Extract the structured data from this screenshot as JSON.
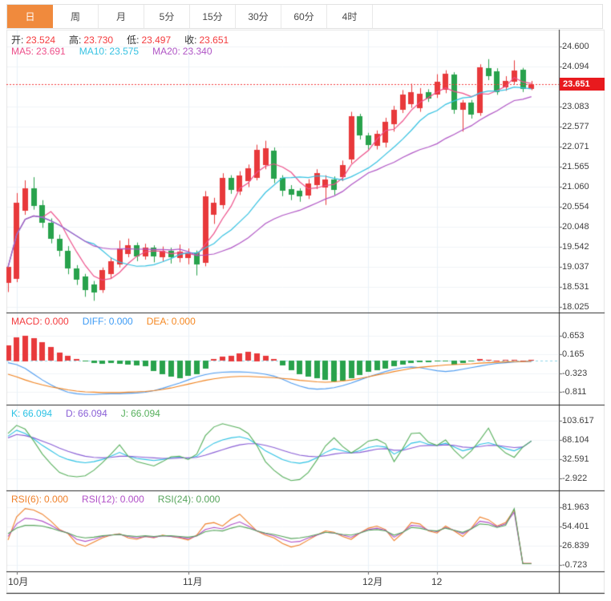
{
  "tabs": [
    {
      "label": "日",
      "active": true
    },
    {
      "label": "周",
      "active": false
    },
    {
      "label": "月",
      "active": false
    },
    {
      "label": "5分",
      "active": false
    },
    {
      "label": "15分",
      "active": false
    },
    {
      "label": "30分",
      "active": false
    },
    {
      "label": "60分",
      "active": false
    },
    {
      "label": "4时",
      "active": false
    }
  ],
  "readouts": {
    "ohlc": [
      {
        "label": "开:",
        "value": "23.524",
        "label_color": "#333333",
        "value_color": "#f43b3e"
      },
      {
        "label": "高:",
        "value": "23.730",
        "label_color": "#333333",
        "value_color": "#f43b3e"
      },
      {
        "label": "低:",
        "value": "23.497",
        "label_color": "#333333",
        "value_color": "#f43b3e"
      },
      {
        "label": "收:",
        "value": "23.651",
        "label_color": "#333333",
        "value_color": "#f43b3e"
      }
    ],
    "ma": [
      {
        "label": "MA5:",
        "value": "23.691",
        "color": "#ee4f8a"
      },
      {
        "label": "MA10:",
        "value": "23.575",
        "color": "#35c2e2"
      },
      {
        "label": "MA20:",
        "value": "23.340",
        "color": "#b055c5"
      }
    ],
    "macd": [
      {
        "label": "MACD:",
        "value": "0.000",
        "color": "#f43b3e"
      },
      {
        "label": "DIFF:",
        "value": "0.000",
        "color": "#3d9bf5"
      },
      {
        "label": "DEA:",
        "value": "0.000",
        "color": "#f58822"
      }
    ],
    "kdj": [
      {
        "label": "K:",
        "value": "66.094",
        "color": "#2cc2e4"
      },
      {
        "label": "D:",
        "value": "66.094",
        "color": "#8a5fd6"
      },
      {
        "label": "J:",
        "value": "66.094",
        "color": "#57b05c"
      }
    ],
    "rsi": [
      {
        "label": "RSI(6):",
        "value": "0.000",
        "color": "#f0812a"
      },
      {
        "label": "RSI(12):",
        "value": "0.000",
        "color": "#b14fc8"
      },
      {
        "label": "RSI(24):",
        "value": "0.000",
        "color": "#57a55c"
      }
    ]
  },
  "price_axis": {
    "last_price": "23.651",
    "ticks": [
      "24.600",
      "24.094",
      "23.083",
      "22.577",
      "22.071",
      "21.565",
      "21.060",
      "20.554",
      "20.048",
      "19.542",
      "19.037",
      "18.531",
      "18.025"
    ]
  },
  "chart_data": {
    "type": "candlestick-with-indicators",
    "title": "",
    "x_axis_labels": [
      {
        "text": "10月",
        "index": 1
      },
      {
        "text": "11月",
        "index": 21
      },
      {
        "text": "12月",
        "index": 42
      },
      {
        "text": "12",
        "index": 50
      }
    ],
    "main": {
      "last_price": 23.651,
      "grid_values": [
        24.6,
        24.094,
        23.588,
        23.083,
        22.577,
        22.071,
        21.565,
        21.06,
        20.554,
        20.048,
        19.542,
        19.037,
        18.531,
        18.025
      ],
      "labeled_values": [
        24.6,
        24.094,
        23.083,
        22.577,
        22.071,
        21.565,
        21.06,
        20.554,
        20.048,
        19.542,
        19.037,
        18.531,
        18.025
      ],
      "ma_periods": [
        5,
        10,
        20
      ],
      "ma_colors": [
        "#ee4f8a",
        "#35c2e2",
        "#b055c5"
      ],
      "up_color": "#e8393b",
      "down_color": "#28a24c",
      "candles_ohlc": [
        [
          18.62,
          19.1,
          18.4,
          19.03
        ],
        [
          18.73,
          20.9,
          18.65,
          20.66
        ],
        [
          20.45,
          21.22,
          20.35,
          21.02
        ],
        [
          21.02,
          21.3,
          20.48,
          20.58
        ],
        [
          20.6,
          20.72,
          20.02,
          20.15
        ],
        [
          20.15,
          20.26,
          19.63,
          19.75
        ],
        [
          19.75,
          19.85,
          19.3,
          19.44
        ],
        [
          19.45,
          19.56,
          18.85,
          19.0
        ],
        [
          19.0,
          19.08,
          18.58,
          18.72
        ],
        [
          18.8,
          18.86,
          18.28,
          18.45
        ],
        [
          18.6,
          18.68,
          18.18,
          18.4
        ],
        [
          18.45,
          19.02,
          18.38,
          18.95
        ],
        [
          18.85,
          19.28,
          18.75,
          19.18
        ],
        [
          19.1,
          19.7,
          19.02,
          19.5
        ],
        [
          19.35,
          19.75,
          19.28,
          19.58
        ],
        [
          19.58,
          19.65,
          19.18,
          19.3
        ],
        [
          19.3,
          19.62,
          19.22,
          19.52
        ],
        [
          19.52,
          19.58,
          19.15,
          19.3
        ],
        [
          19.28,
          19.55,
          19.18,
          19.45
        ],
        [
          19.45,
          19.52,
          19.12,
          19.28
        ],
        [
          19.25,
          19.6,
          19.15,
          19.42
        ],
        [
          19.25,
          19.5,
          19.1,
          19.4
        ],
        [
          19.4,
          19.45,
          18.82,
          19.1
        ],
        [
          19.15,
          20.95,
          19.05,
          20.82
        ],
        [
          20.35,
          20.78,
          20.12,
          20.65
        ],
        [
          20.6,
          21.4,
          20.5,
          21.28
        ],
        [
          21.28,
          21.35,
          20.88,
          20.98
        ],
        [
          20.95,
          21.45,
          20.85,
          21.35
        ],
        [
          21.2,
          21.62,
          21.05,
          21.52
        ],
        [
          21.3,
          22.12,
          21.22,
          22.0
        ],
        [
          21.6,
          22.22,
          21.5,
          22.03
        ],
        [
          21.98,
          22.05,
          21.15,
          21.28
        ],
        [
          21.28,
          21.35,
          20.82,
          20.95
        ],
        [
          21.0,
          21.1,
          20.72,
          20.85
        ],
        [
          20.95,
          21.02,
          20.68,
          20.8
        ],
        [
          20.85,
          21.25,
          20.75,
          21.15
        ],
        [
          21.1,
          21.5,
          21.0,
          21.4
        ],
        [
          21.05,
          21.35,
          20.6,
          21.25
        ],
        [
          21.25,
          21.32,
          20.85,
          20.98
        ],
        [
          21.3,
          21.72,
          21.2,
          21.6
        ],
        [
          21.75,
          22.95,
          21.65,
          22.84
        ],
        [
          22.84,
          22.9,
          22.25,
          22.35
        ],
        [
          22.35,
          22.42,
          22.0,
          22.1
        ],
        [
          22.1,
          22.48,
          22.0,
          22.4
        ],
        [
          22.17,
          22.8,
          22.05,
          22.7
        ],
        [
          22.64,
          23.1,
          22.45,
          23.0
        ],
        [
          23.0,
          23.5,
          22.92,
          23.39
        ],
        [
          23.14,
          23.66,
          23.05,
          23.45
        ],
        [
          23.05,
          23.55,
          22.95,
          23.41
        ],
        [
          23.45,
          23.52,
          23.2,
          23.29
        ],
        [
          23.39,
          23.9,
          23.3,
          23.71
        ],
        [
          23.51,
          24.0,
          23.42,
          23.91
        ],
        [
          23.89,
          23.95,
          22.9,
          23.0
        ],
        [
          23.0,
          23.25,
          22.45,
          23.18
        ],
        [
          23.18,
          23.25,
          22.78,
          22.87
        ],
        [
          22.93,
          24.15,
          22.85,
          24.08
        ],
        [
          24.05,
          24.28,
          23.75,
          23.85
        ],
        [
          23.98,
          24.05,
          23.38,
          23.45
        ],
        [
          23.55,
          23.85,
          23.48,
          23.72
        ],
        [
          23.71,
          24.25,
          23.65,
          23.99
        ],
        [
          24.01,
          24.06,
          23.45,
          23.52
        ],
        [
          23.524,
          23.73,
          23.497,
          23.651
        ]
      ]
    },
    "macd_panel": {
      "grid_values": [
        0.653,
        0.165,
        -0.323,
        -0.811
      ],
      "hist": [
        0.4,
        0.62,
        0.66,
        0.58,
        0.48,
        0.36,
        0.22,
        0.12,
        0.05,
        -0.03,
        -0.06,
        -0.08,
        -0.06,
        -0.08,
        -0.1,
        -0.12,
        -0.14,
        -0.28,
        -0.35,
        -0.42,
        -0.45,
        -0.4,
        -0.35,
        -0.2,
        0.04,
        0.1,
        0.14,
        0.2,
        0.24,
        0.2,
        0.12,
        0.04,
        -0.12,
        -0.25,
        -0.35,
        -0.42,
        -0.46,
        -0.5,
        -0.55,
        -0.52,
        -0.45,
        -0.38,
        -0.3,
        -0.25,
        -0.2,
        -0.15,
        -0.1,
        -0.06,
        -0.05,
        -0.04,
        -0.03,
        -0.02,
        -0.1,
        -0.06,
        -0.02,
        0.04,
        0.02,
        0.01,
        0.02,
        0.03,
        0.01,
        0.02
      ],
      "diff": [
        -0.05,
        -0.1,
        -0.2,
        -0.35,
        -0.5,
        -0.63,
        -0.74,
        -0.82,
        -0.86,
        -0.88,
        -0.88,
        -0.87,
        -0.86,
        -0.86,
        -0.85,
        -0.84,
        -0.82,
        -0.78,
        -0.72,
        -0.65,
        -0.58,
        -0.5,
        -0.42,
        -0.36,
        -0.32,
        -0.3,
        -0.29,
        -0.29,
        -0.3,
        -0.32,
        -0.35,
        -0.4,
        -0.48,
        -0.58,
        -0.66,
        -0.72,
        -0.74,
        -0.73,
        -0.7,
        -0.65,
        -0.58,
        -0.5,
        -0.42,
        -0.35,
        -0.28,
        -0.22,
        -0.18,
        -0.16,
        -0.18,
        -0.22,
        -0.26,
        -0.28,
        -0.26,
        -0.22,
        -0.18,
        -0.14,
        -0.1,
        -0.07,
        -0.05,
        -0.03,
        -0.02,
        -0.02
      ],
      "dea": [
        -0.35,
        -0.42,
        -0.5,
        -0.57,
        -0.63,
        -0.68,
        -0.72,
        -0.76,
        -0.79,
        -0.81,
        -0.82,
        -0.83,
        -0.83,
        -0.83,
        -0.82,
        -0.81,
        -0.8,
        -0.78,
        -0.75,
        -0.71,
        -0.66,
        -0.61,
        -0.56,
        -0.51,
        -0.47,
        -0.44,
        -0.42,
        -0.41,
        -0.41,
        -0.42,
        -0.43,
        -0.44,
        -0.46,
        -0.48,
        -0.51,
        -0.53,
        -0.55,
        -0.56,
        -0.55,
        -0.53,
        -0.5,
        -0.46,
        -0.42,
        -0.37,
        -0.33,
        -0.28,
        -0.24,
        -0.2,
        -0.17,
        -0.15,
        -0.13,
        -0.11,
        -0.1,
        -0.09,
        -0.08,
        -0.06,
        -0.05,
        -0.04,
        -0.03,
        -0.02,
        -0.02,
        -0.01
      ],
      "colors": {
        "hist_up": "#e8393b",
        "hist_down": "#28a24c",
        "diff": "#4f9cf0",
        "dea": "#f0821e",
        "zero_line": "#8fd8ea"
      }
    },
    "kdj_panel": {
      "grid_values": [
        103.617,
        68.104,
        32.591,
        -2.922
      ],
      "k": [
        75,
        86,
        80,
        70,
        58,
        48,
        38,
        32,
        28,
        26,
        28,
        32,
        38,
        45,
        38,
        34,
        32,
        30,
        32,
        35,
        36,
        34,
        38,
        52,
        62,
        68,
        72,
        74,
        70,
        60,
        48,
        40,
        32,
        27,
        25,
        28,
        35,
        45,
        52,
        48,
        44,
        48,
        54,
        57,
        55,
        42,
        50,
        62,
        65,
        60,
        58,
        62,
        55,
        48,
        52,
        60,
        63,
        58,
        52,
        48,
        55,
        66.094
      ],
      "d": [
        72,
        78,
        76,
        72,
        66,
        60,
        53,
        47,
        42,
        38,
        36,
        35,
        36,
        38,
        38,
        37,
        36,
        35,
        34,
        34,
        35,
        35,
        36,
        40,
        45,
        50,
        55,
        59,
        61,
        61,
        58,
        54,
        49,
        44,
        40,
        38,
        37,
        39,
        42,
        44,
        44,
        45,
        48,
        51,
        52,
        49,
        49,
        53,
        57,
        58,
        58,
        59,
        58,
        55,
        54,
        56,
        58,
        58,
        56,
        54,
        55,
        66.094
      ],
      "j": [
        80,
        95,
        88,
        66,
        42,
        24,
        8,
        2,
        0,
        2,
        12,
        26,
        42,
        59,
        38,
        28,
        24,
        20,
        28,
        37,
        38,
        32,
        42,
        76,
        92,
        98,
        94,
        90,
        80,
        58,
        28,
        12,
        0,
        -7,
        -5,
        8,
        31,
        57,
        72,
        56,
        44,
        54,
        66,
        69,
        61,
        28,
        52,
        80,
        81,
        64,
        58,
        68,
        49,
        34,
        48,
        68,
        90,
        58,
        44,
        36,
        55,
        66.094
      ],
      "colors": {
        "k": "#2cc2e4",
        "d": "#8a5fd6",
        "j": "#57b05c"
      }
    },
    "rsi_panel": {
      "grid_values": [
        81.963,
        54.401,
        26.839,
        -0.723
      ],
      "rsi6": [
        35,
        68,
        80,
        78,
        72,
        62,
        50,
        44,
        30,
        26,
        32,
        38,
        42,
        44,
        38,
        36,
        40,
        38,
        42,
        40,
        38,
        35,
        42,
        58,
        60,
        55,
        65,
        72,
        60,
        48,
        42,
        38,
        30,
        25,
        28,
        35,
        42,
        48,
        46,
        40,
        36,
        45,
        52,
        55,
        50,
        34,
        45,
        60,
        58,
        48,
        45,
        55,
        48,
        40,
        52,
        68,
        64,
        55,
        60,
        78,
        1.5,
        1.5
      ],
      "rsi12": [
        40,
        58,
        66,
        65,
        62,
        56,
        49,
        45,
        36,
        33,
        36,
        40,
        42,
        43,
        40,
        38,
        40,
        39,
        41,
        40,
        39,
        37,
        41,
        50,
        53,
        51,
        57,
        61,
        55,
        48,
        44,
        41,
        36,
        32,
        33,
        38,
        42,
        46,
        45,
        42,
        39,
        45,
        50,
        52,
        49,
        39,
        46,
        56,
        55,
        49,
        47,
        53,
        49,
        44,
        51,
        62,
        60,
        54,
        58,
        75,
        1.2,
        1.2
      ],
      "rsi24": [
        44,
        52,
        56,
        56,
        55,
        52,
        48,
        45,
        40,
        38,
        39,
        41,
        42,
        43,
        41,
        40,
        41,
        40,
        41,
        41,
        40,
        39,
        41,
        47,
        49,
        48,
        52,
        55,
        52,
        48,
        45,
        43,
        40,
        37,
        38,
        40,
        43,
        46,
        45,
        43,
        42,
        45,
        49,
        50,
        48,
        42,
        46,
        53,
        52,
        49,
        48,
        52,
        49,
        46,
        51,
        58,
        57,
        53,
        56,
        80,
        1.0,
        1.0
      ],
      "colors": {
        "rsi6": "#f0812a",
        "rsi12": "#b14fc8",
        "rsi24": "#57a55c"
      }
    },
    "style": {
      "grid_color": "#f1f4f8",
      "vgrid_color": "#e9f1f8",
      "separator_color": "#2b2b2b",
      "border_color": "#e3e3e3",
      "dotted_price_color": "#f43b3e",
      "badge_color": "#e81a1e",
      "tab_active_color": "#f08a3d"
    }
  }
}
